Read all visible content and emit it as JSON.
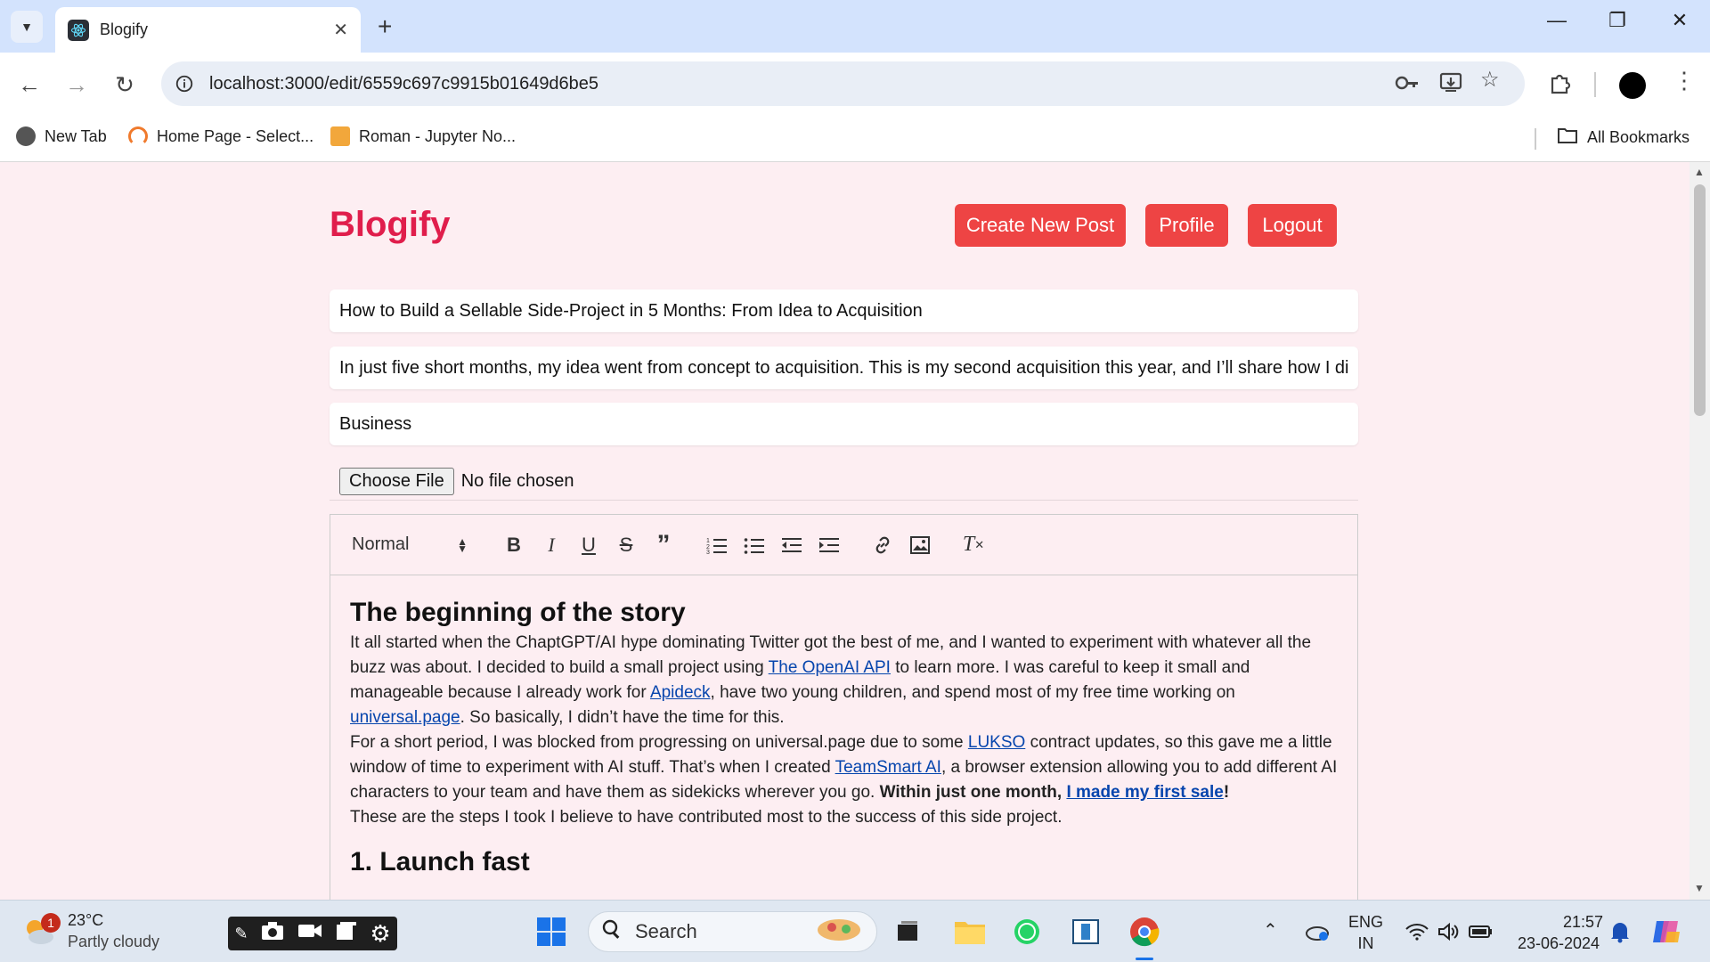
{
  "browser": {
    "tab_title": "Blogify",
    "url": "localhost:3000/edit/6559c697c9915b01649d6be5",
    "bookmarks": [
      {
        "label": "New Tab"
      },
      {
        "label": "Home Page - Select..."
      },
      {
        "label": "Roman - Jupyter No..."
      }
    ],
    "all_bookmarks": "All Bookmarks"
  },
  "header": {
    "brand": "Blogify",
    "buttons": {
      "create": "Create New Post",
      "profile": "Profile",
      "logout": "Logout"
    }
  },
  "form": {
    "title": "How to Build a Sellable Side-Project in 5 Months: From Idea to Acquisition",
    "summary": "In just five short months, my idea went from concept to acquisition. This is my second acquisition this year, and I’ll share how I di",
    "category": "Business",
    "file_button": "Choose File",
    "file_status": "No file chosen"
  },
  "editor": {
    "format_picker": "Normal",
    "heading": "The beginning of the story",
    "p1_a": "It all started when the ChaptGPT/AI hype dominating Twitter got the best of me, and I wanted to experiment with whatever all the buzz was about. I decided to build a small project using ",
    "p1_link1": "The OpenAI API",
    "p1_b": " to learn more. I was careful to keep it small and manageable because I already work for ",
    "p1_link2": "Apideck",
    "p1_c": ", have two young children, and spend most of my free time working on ",
    "p1_link3": "universal.page",
    "p1_d": ". So basically, I didn’t have the time for this.",
    "p2_a": "For a short period, I was blocked from progressing on universal.page due to some ",
    "p2_link1": "LUKSO",
    "p2_b": " contract updates, so this gave me a little window of time to experiment with AI stuff. That’s when I created ",
    "p2_link2": "TeamSmart AI",
    "p2_c": ", a browser extension allowing you to add different AI characters to your team and have them as sidekicks wherever you go. ",
    "p2_bold": "Within just one month, ",
    "p2_link3": "I made my first sale",
    "p2_excl": "!",
    "p3": "These are the steps I took I believe to have contributed most to the success of this side project.",
    "heading2": "1. Launch fast"
  },
  "taskbar": {
    "weather_temp": "23°C",
    "weather_desc": "Partly cloudy",
    "weather_badge": "1",
    "search": "Search",
    "lang_top": "ENG",
    "lang_bottom": "IN",
    "time": "21:57",
    "date": "23-06-2024"
  }
}
